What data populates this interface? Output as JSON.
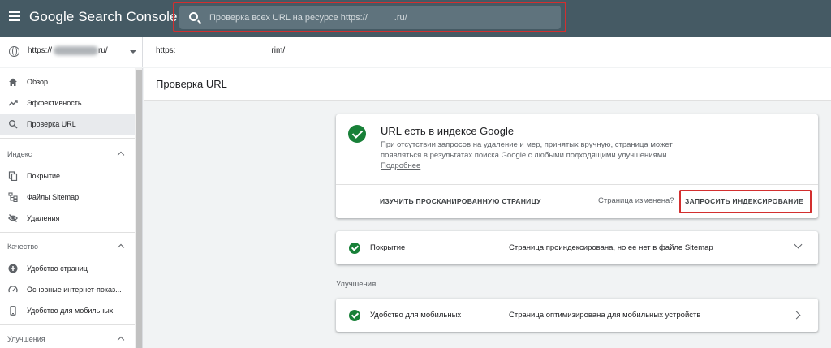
{
  "header": {
    "brand": "Google Search Console",
    "search_placeholder": "Проверка всех URL на ресурсе https://",
    "search_suffix": ".ru/",
    "menu_icon": "menu-icon",
    "accent": "#455a64",
    "highlight": "#d32f2f"
  },
  "property": {
    "prefix": "https://",
    "suffix": "ru/",
    "inspected_url_prefix": "https:",
    "inspected_url_suffix": "rim/"
  },
  "sidebar": {
    "items_top": [
      {
        "label": "Обзор",
        "icon": "home-icon"
      },
      {
        "label": "Эффективность",
        "icon": "trending-up-icon"
      },
      {
        "label": "Проверка URL",
        "icon": "search-icon"
      }
    ],
    "section_index": "Индекс",
    "items_index": [
      {
        "label": "Покрытие",
        "icon": "copy-icon"
      },
      {
        "label": "Файлы Sitemap",
        "icon": "sitemap-icon"
      },
      {
        "label": "Удаления",
        "icon": "eye-off-icon"
      }
    ],
    "section_quality": "Качество",
    "items_quality": [
      {
        "label": "Удобство страниц",
        "icon": "plus-circle-icon"
      },
      {
        "label": "Основные интернет-показ...",
        "icon": "speed-icon"
      },
      {
        "label": "Удобство для мобильных",
        "icon": "phone-icon"
      }
    ],
    "section_improvements": "Улучшения"
  },
  "main": {
    "title": "Проверка URL",
    "status": {
      "title": "URL есть в индексе Google",
      "description": "При отсутствии запросов на удаление и мер, принятых вручную, страница может появляться в результатах поиска Google с любыми подходящими улучшениями.",
      "more_link": "Подробнее",
      "view_crawled": "ИЗУЧИТЬ ПРОСКАНИРОВАННУЮ СТРАНИЦУ",
      "changed_question": "Страница изменена?",
      "request_indexing": "ЗАПРОСИТЬ ИНДЕКСИРОВАНИЕ"
    },
    "coverage": {
      "label": "Покрытие",
      "value": "Страница проиндексирована, но ее нет в файле Sitemap"
    },
    "improvements_heading": "Улучшения",
    "mobile": {
      "label": "Удобство для мобильных",
      "value": "Страница оптимизирована для мобильных устройств"
    }
  }
}
